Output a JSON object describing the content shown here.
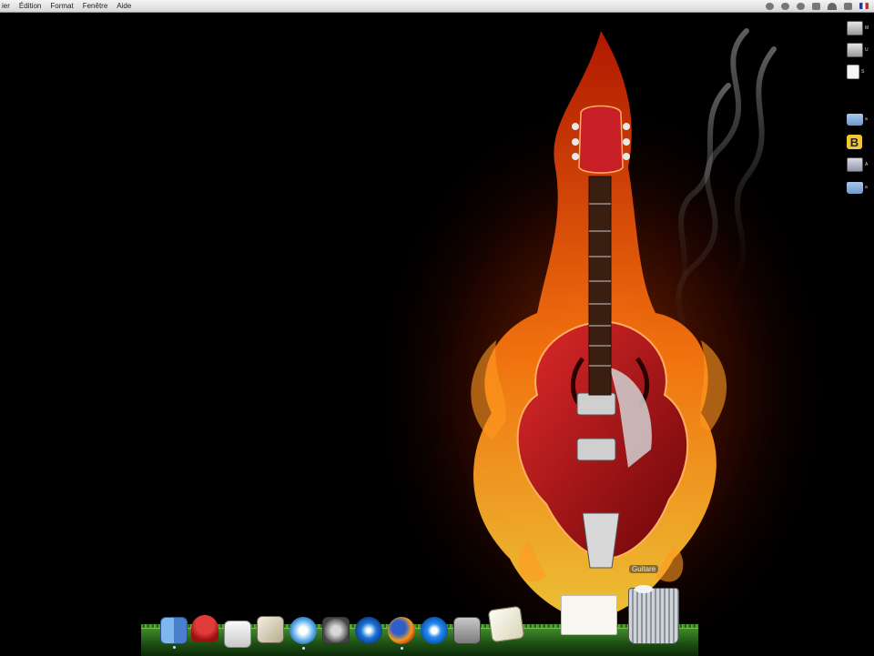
{
  "menubar": {
    "items": [
      "ier",
      "Édition",
      "Format",
      "Fenêtre",
      "Aide"
    ]
  },
  "status_icons": [
    "time-machine-icon",
    "sync-icon",
    "power-icon",
    "bluetooth-icon",
    "wifi-icon",
    "volume-icon",
    "french-flag-icon"
  ],
  "wallpaper": {
    "label": "Guitare"
  },
  "desktop_icons": [
    {
      "type": "disk",
      "label": "M"
    },
    {
      "type": "disk",
      "label": "U"
    },
    {
      "type": "doc",
      "label": "S"
    },
    {
      "type": "folder",
      "label": "a"
    },
    {
      "type": "app-b",
      "label": "B"
    },
    {
      "type": "app-a",
      "label": "A"
    },
    {
      "type": "folder",
      "label": "a"
    }
  ],
  "dock": {
    "items": [
      "finder",
      "stamp",
      "printer",
      "photos",
      "itunes",
      "system-preferences",
      "dvd-player",
      "firefox",
      "quicktime",
      "iphoto",
      "preview",
      "documents-stack",
      "trash"
    ]
  },
  "colors": {
    "menubar": "#e6e6e6",
    "flame": "#ff6a00",
    "guitar": "#c21d25",
    "dock_grass": "#3e8a2a"
  }
}
